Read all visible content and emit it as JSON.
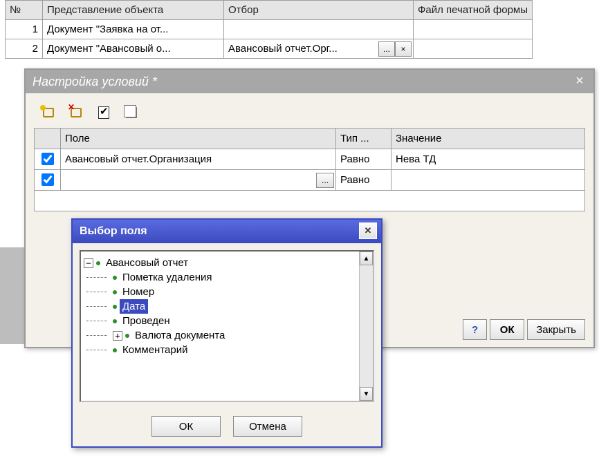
{
  "topGrid": {
    "headers": {
      "num": "№",
      "repr": "Представление объекта",
      "filter": "Отбор",
      "file": "Файл печатной формы"
    },
    "rows": [
      {
        "num": "1",
        "repr": "Документ \"Заявка на от...",
        "filter": "",
        "file": ""
      },
      {
        "num": "2",
        "repr": "Документ \"Авансовый о...",
        "filter": "Авансовый отчет.Орг...",
        "file": ""
      }
    ],
    "filterBrowse": "...",
    "filterClear": "×"
  },
  "settings": {
    "title": "Настройка условий *",
    "close": "×",
    "headers": {
      "check": "",
      "field": "Поле",
      "type": "Тип ...",
      "value": "Значение"
    },
    "rows": [
      {
        "checked": true,
        "field": "Авансовый отчет.Организация",
        "type": "Равно",
        "value": "Нева ТД",
        "editing": false
      },
      {
        "checked": true,
        "field": "",
        "type": "Равно",
        "value": "",
        "editing": true
      }
    ],
    "more": "...",
    "buttons": {
      "help": "?",
      "ok": "ОК",
      "close": "Закрыть"
    }
  },
  "picker": {
    "title": "Выбор поля",
    "close": "✕",
    "root": {
      "label": "Авансовый отчет",
      "expanded": true
    },
    "items": [
      {
        "label": "Пометка удаления",
        "expandable": false,
        "selected": false
      },
      {
        "label": "Номер",
        "expandable": false,
        "selected": false
      },
      {
        "label": "Дата",
        "expandable": false,
        "selected": true
      },
      {
        "label": "Проведен",
        "expandable": false,
        "selected": false
      },
      {
        "label": "Валюта документа",
        "expandable": true,
        "selected": false
      },
      {
        "label": "Комментарий",
        "expandable": false,
        "selected": false
      }
    ],
    "scroll": {
      "up": "▲",
      "down": "▼"
    },
    "buttons": {
      "ok": "ОК",
      "cancel": "Отмена"
    }
  }
}
